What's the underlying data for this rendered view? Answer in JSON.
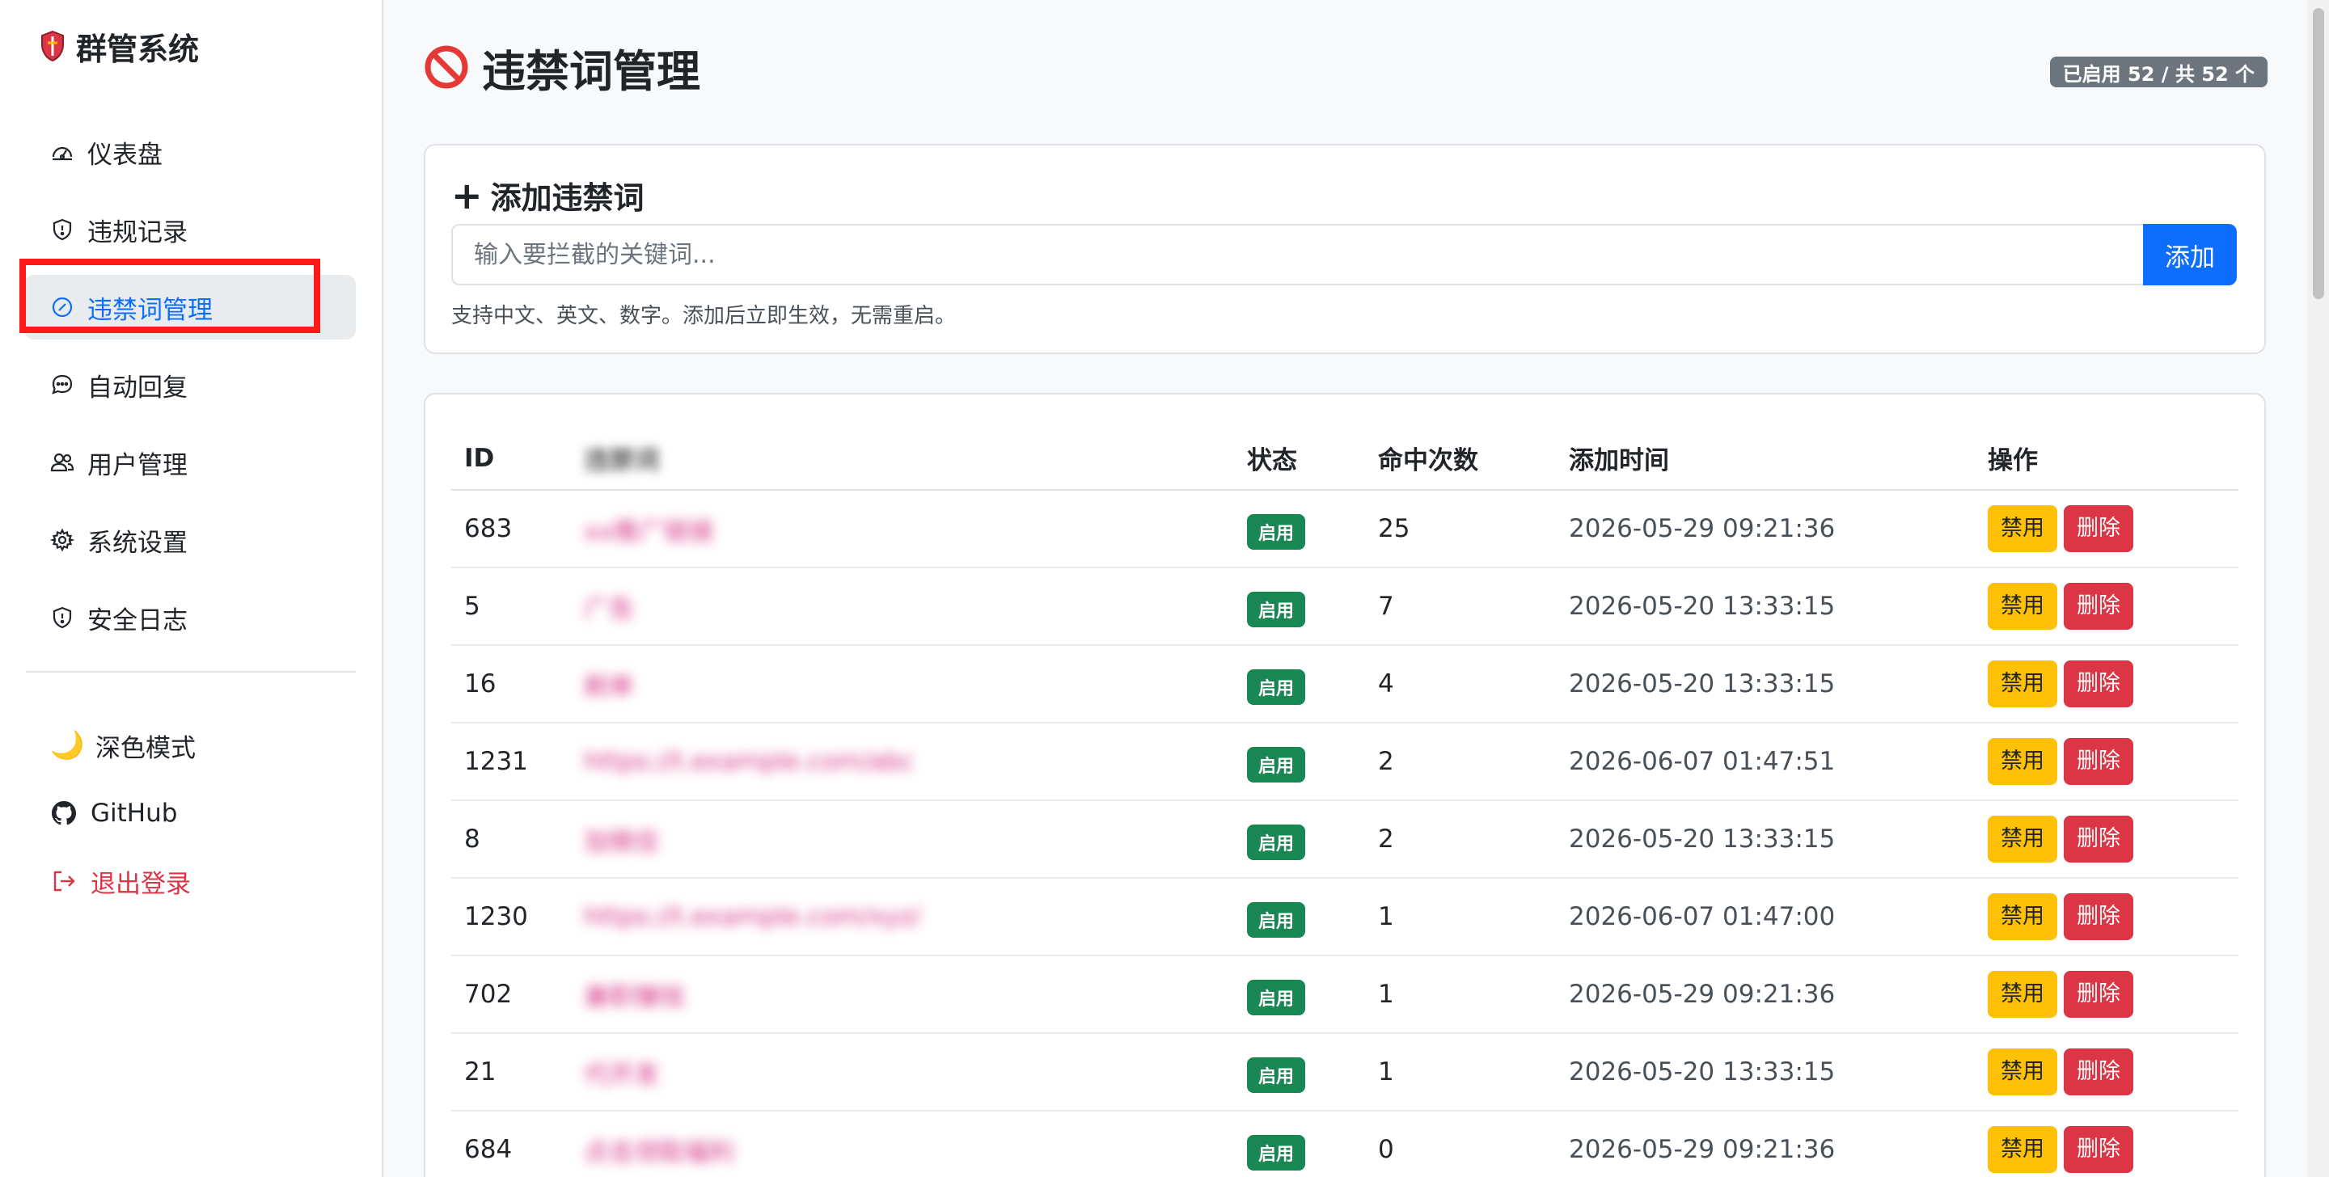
{
  "brand": {
    "name": "群管系统"
  },
  "sidebar": {
    "items": [
      {
        "label": "仪表盘",
        "icon": "dashboard-icon"
      },
      {
        "label": "违规记录",
        "icon": "shield-icon"
      },
      {
        "label": "违禁词管理",
        "icon": "slash-circle-icon",
        "active": true
      },
      {
        "label": "自动回复",
        "icon": "chat-icon"
      },
      {
        "label": "用户管理",
        "icon": "users-icon"
      },
      {
        "label": "系统设置",
        "icon": "gear-icon"
      },
      {
        "label": "安全日志",
        "icon": "shield-icon"
      }
    ],
    "dark_mode": "深色模式",
    "github": "GitHub",
    "logout": "退出登录"
  },
  "page": {
    "title": "违禁词管理",
    "count_badge": "已启用 52 / 共 52 个"
  },
  "add_form": {
    "title": "添加违禁词",
    "placeholder": "输入要拦截的关键词...",
    "button": "添加",
    "help": "支持中文、英文、数字。添加后立即生效，无需重启。"
  },
  "table": {
    "headers": [
      "ID",
      "违禁词",
      "状态",
      "命中次数",
      "添加时间",
      "操作"
    ],
    "rows": [
      {
        "id": "683",
        "word": "xx推广链接",
        "status": "启用",
        "hits": "25",
        "time": "2026-05-29 09:21:36"
      },
      {
        "id": "5",
        "word": "广告",
        "status": "启用",
        "hits": "7",
        "time": "2026-05-20 13:33:15"
      },
      {
        "id": "16",
        "word": "刷单",
        "status": "启用",
        "hits": "4",
        "time": "2026-05-20 13:33:15"
      },
      {
        "id": "1231",
        "word": "https://t.example.com/abc",
        "status": "启用",
        "hits": "2",
        "time": "2026-06-07 01:47:51"
      },
      {
        "id": "8",
        "word": "加微信",
        "status": "启用",
        "hits": "2",
        "time": "2026-05-20 13:33:15"
      },
      {
        "id": "1230",
        "word": "https://t.example.com/xyz/",
        "status": "启用",
        "hits": "1",
        "time": "2026-06-07 01:47:00"
      },
      {
        "id": "702",
        "word": "兼职赚钱",
        "status": "启用",
        "hits": "1",
        "time": "2026-05-29 09:21:36"
      },
      {
        "id": "21",
        "word": "代开发",
        "status": "启用",
        "hits": "1",
        "time": "2026-05-20 13:33:15"
      },
      {
        "id": "684",
        "word": "点击领取福利",
        "status": "启用",
        "hits": "0",
        "time": "2026-05-29 09:21:36"
      }
    ],
    "actions": {
      "disable": "禁用",
      "delete": "删除"
    }
  },
  "colors": {
    "primary": "#0d6efd",
    "success": "#198754",
    "warning": "#ffc107",
    "danger": "#dc3545",
    "badge": "#6c757d",
    "highlight": "#ff1a1a"
  }
}
